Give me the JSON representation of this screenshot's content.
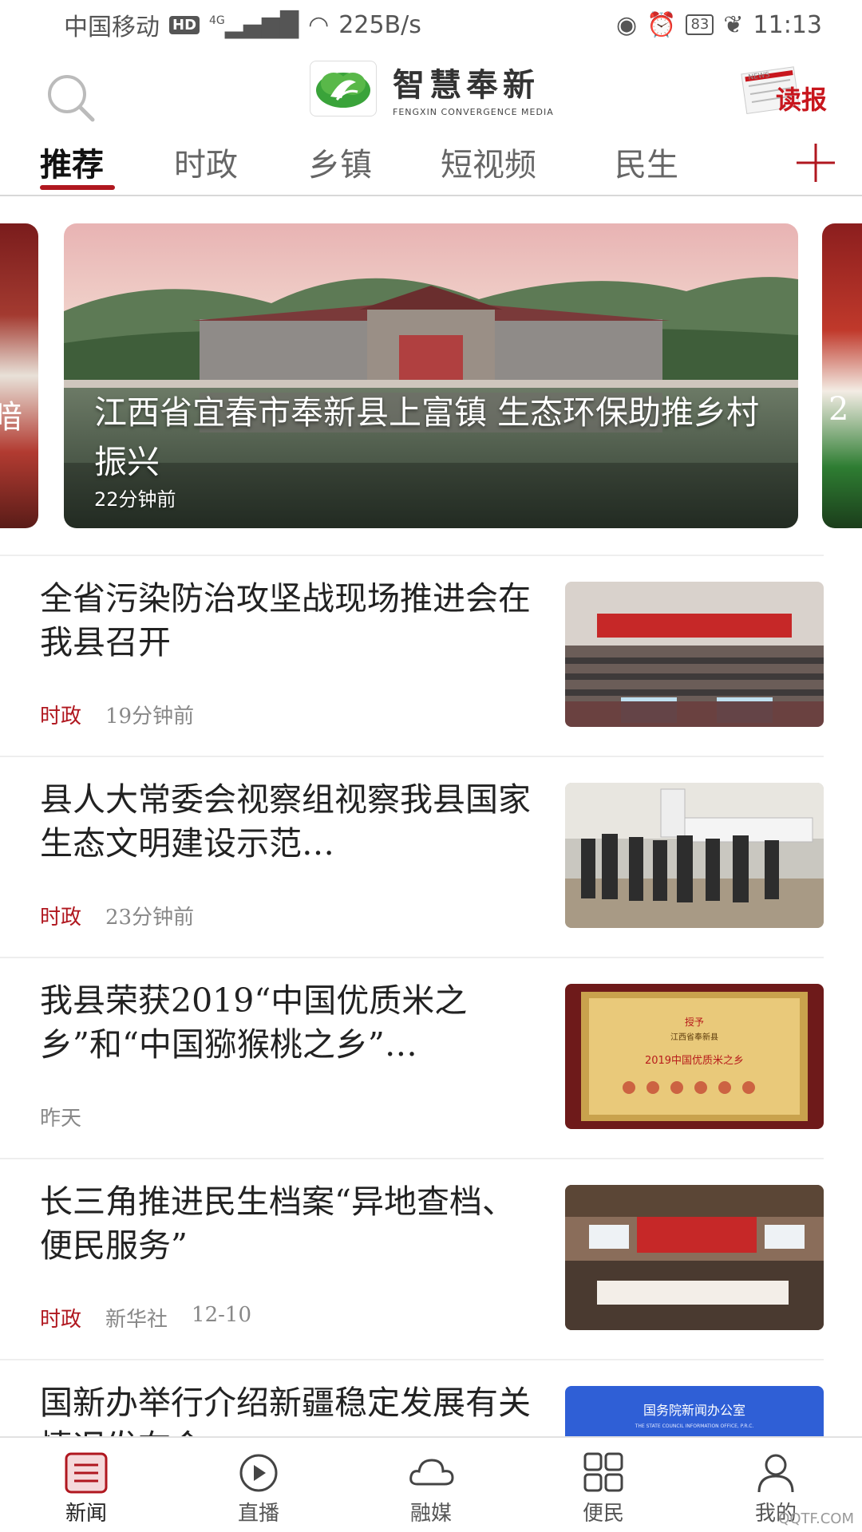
{
  "status_bar": {
    "carrier": "中国移动",
    "hd": "HD",
    "network": "4G",
    "speed": "225B/s",
    "battery": "83",
    "time": "11:13"
  },
  "header": {
    "logo_title": "智慧奉新",
    "logo_subtitle": "FENGXIN CONVERGENCE MEDIA",
    "read_paper_label": "读报",
    "read_paper_small": "NEWS"
  },
  "tabs": [
    {
      "label": "推荐",
      "active": true
    },
    {
      "label": "时政",
      "active": false
    },
    {
      "label": "乡镇",
      "active": false
    },
    {
      "label": "短视频",
      "active": false
    },
    {
      "label": "民生",
      "active": false
    }
  ],
  "carousel": {
    "peek_left_text": "暗",
    "peek_right_text": "2",
    "slide": {
      "title": "江西省宜春市奉新县上富镇 生态环保助推乡村振兴",
      "time": "22分钟前"
    }
  },
  "news": [
    {
      "title": "全省污染防治攻坚战现场推进会在我县召开",
      "category": "时政",
      "source": "",
      "time": "19分钟前",
      "thumb": "conference"
    },
    {
      "title": "县人大常委会视察组视察我县国家生态文明建设示范…",
      "category": "时政",
      "source": "",
      "time": "23分钟前",
      "thumb": "field-visit"
    },
    {
      "title": "我县荣获2019“中国优质米之乡”和“中国猕猴桃之乡”…",
      "category": "",
      "source": "",
      "time": "昨天",
      "thumb": "certificate"
    },
    {
      "title": "长三角推进民生档案“异地查档、便民服务”",
      "category": "时政",
      "source": "新华社",
      "time": "12-10",
      "thumb": "meeting"
    },
    {
      "title": "国新办举行介绍新疆稳定发展有关情况发布会",
      "category": "",
      "source": "",
      "time": "",
      "thumb": "press"
    }
  ],
  "certificate_text": {
    "line1": "授予",
    "line2": "江西省奉新县",
    "line3": "2019中国优质米之乡"
  },
  "press_thumb_text": {
    "line1": "国务院新闻办公室",
    "line2": "THE STATE COUNCIL INFORMATION OFFICE, P.R.C."
  },
  "bottom_nav": [
    {
      "label": "新闻",
      "icon": "news-list-icon",
      "active": true
    },
    {
      "label": "直播",
      "icon": "play-circle-icon",
      "active": false
    },
    {
      "label": "融媒",
      "icon": "cloud-icon",
      "active": false
    },
    {
      "label": "便民",
      "icon": "grid-icon",
      "active": false
    },
    {
      "label": "我的",
      "icon": "person-icon",
      "active": false
    }
  ],
  "watermark": "QQTF.COM",
  "colors": {
    "accent": "#b0171f",
    "logo_green": "#3aa33a"
  }
}
